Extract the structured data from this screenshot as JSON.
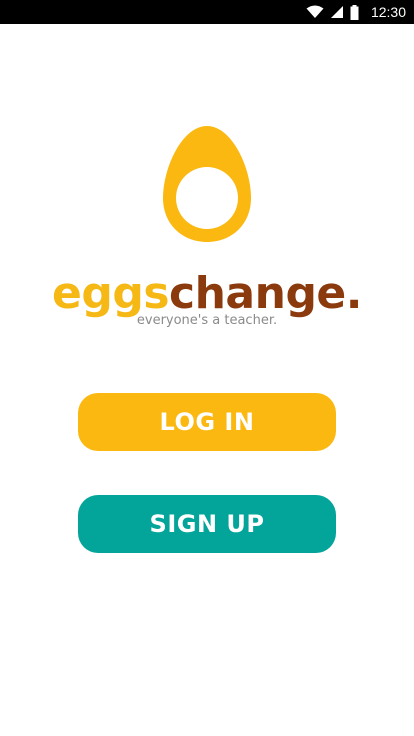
{
  "status_bar": {
    "time": "12:30",
    "icons": [
      "wifi-icon",
      "cellular-signal-icon",
      "battery-icon"
    ]
  },
  "logo": {
    "icon": "egg-icon",
    "brand_part1": "eggs",
    "brand_part2": "change.",
    "tagline": "everyone's a teacher."
  },
  "actions": {
    "login_label": "LOG IN",
    "signup_label": "SIGN UP"
  },
  "colors": {
    "primary_yellow": "#FBB811",
    "brand_brown": "#8B3A0E",
    "teal": "#03A59A",
    "tagline_gray": "#8a8a8a",
    "status_bar": "#000000"
  }
}
